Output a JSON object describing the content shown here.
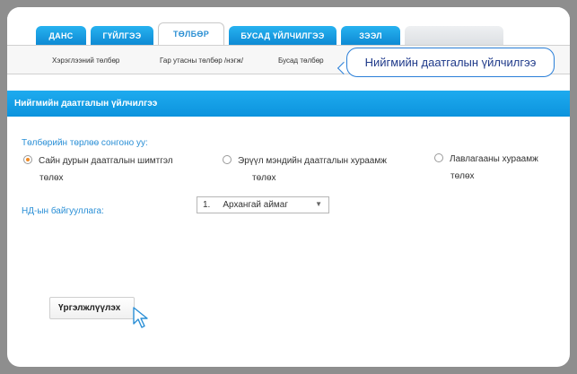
{
  "tabs": [
    {
      "label": "ДАНС"
    },
    {
      "label": "ГҮЙЛГЭЭ"
    },
    {
      "label": "ТӨЛБӨР",
      "active": true
    },
    {
      "label": "БУСАД ҮЙЛЧИЛГЭЭ"
    },
    {
      "label": "ЗЭЭЛ"
    }
  ],
  "subnav": [
    {
      "label": "Хэрэглээний төлбөр"
    },
    {
      "label": "Гар утасны төлбөр /нэгж/"
    },
    {
      "label": "Бусад төлбөр"
    }
  ],
  "callout": {
    "text": "Нийгмийн даатгалын үйлчилгээ"
  },
  "section": {
    "title": "Нийгмийн даатгалын үйлчилгээ"
  },
  "form": {
    "question": "Төлбөрийн төрлөө сонгоно уу:",
    "options": [
      {
        "line1": "Сайн дурын даатгалын шимтгэл",
        "line2": "төлөх",
        "checked": true
      },
      {
        "line1": "Эрүүл мэндийн даатгалын хураамж",
        "line2": "төлөх",
        "checked": false
      },
      {
        "line1": "Лавлагааны хураамж",
        "line2": "төлөх",
        "checked": false
      }
    ],
    "branch_label": "НД-ын байгууллага:",
    "branch_select": {
      "number": "1.",
      "value": "Архангай аймаг"
    },
    "continue_label": "Үргэлжлүүлэх"
  },
  "icons": {
    "caret": "chevron-down-icon",
    "cursor": "mouse-pointer-icon"
  },
  "colors": {
    "accent": "#1eabef",
    "link": "#2a8fd6",
    "radio_checked": "#f08a24",
    "callout_border": "#2a7fd8"
  }
}
